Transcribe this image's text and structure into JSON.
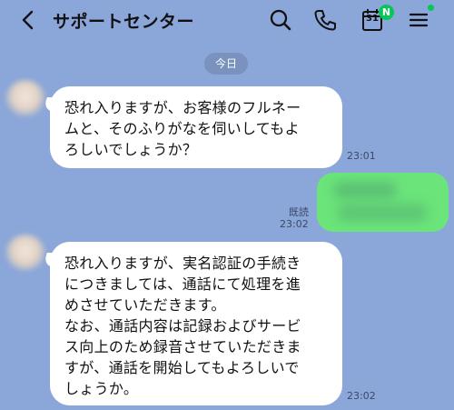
{
  "header": {
    "title": "サポートセンター",
    "calendar_day": "31",
    "calendar_badge": "N"
  },
  "date_divider": "今日",
  "messages": [
    {
      "sender": "incoming",
      "text": "恐れ入りますが、お客様のフルネー\nムと、そのふりがなを伺いしてもよ\nろしいでしょうか？",
      "time": "23:01"
    },
    {
      "sender": "outgoing",
      "read_label": "既読",
      "time": "23:02"
    },
    {
      "sender": "incoming",
      "text": "恐れ入りますが、実名認証の手続き\nにつきましては、通話にて処理を進\nめさせていただきます。\nなお、通話内容は記録およびサービ\nス向上のため録音させていただきま\nすが、通話を開始してもよろしいで\nしょうか。",
      "time": "23:02"
    }
  ],
  "colors": {
    "background": "#8ba6d8",
    "outgoing_bubble": "#6be57a",
    "badge": "#06c755"
  }
}
